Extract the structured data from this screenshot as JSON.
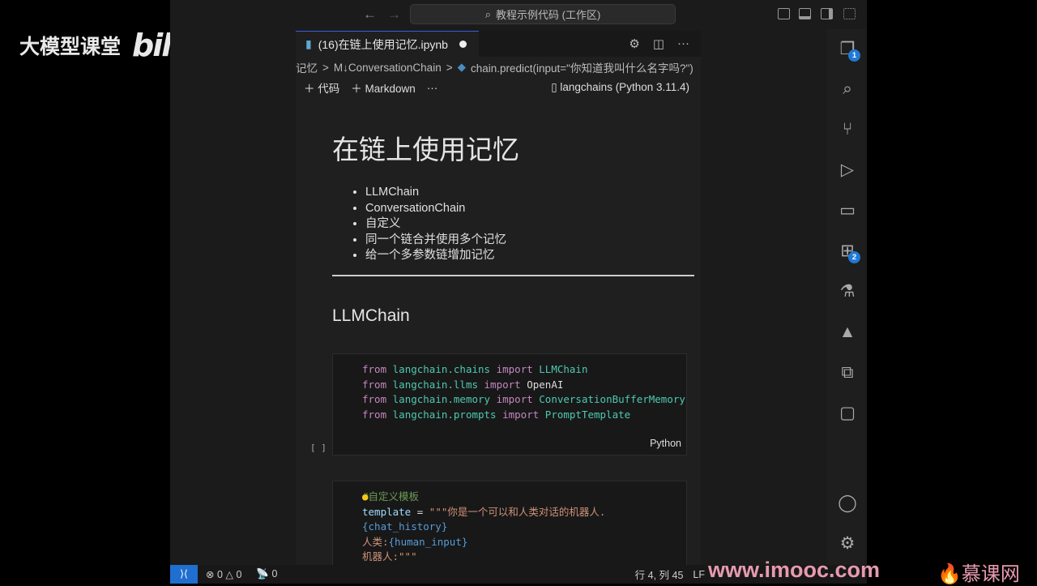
{
  "watermark": {
    "course": "大模型课堂",
    "logo": "bilibili",
    "site": "www.imooc.com",
    "brand": "慕课网"
  },
  "titlebar": {
    "search": "教程示例代码 (工作区)"
  },
  "tab": {
    "title": "(16)在链上使用记忆.ipynb"
  },
  "breadcrumbs": [
    "记忆",
    ">",
    "M↓ConversationChain",
    ">",
    "chain.predict(input=\"你知道我叫什么名字吗?\")"
  ],
  "toolbar": {
    "add_code": "代码",
    "add_markdown": "Markdown",
    "more": "···",
    "kernel": "langchains (Python 3.11.4)"
  },
  "notebook": {
    "title": "在链上使用记忆",
    "bullets": [
      "LLMChain",
      "ConversationChain",
      "自定义",
      "同一个链合并使用多个记忆",
      "给一个多参数链增加记忆"
    ],
    "section": "LLMChain",
    "cell1": {
      "lines": [
        [
          "from",
          "langchain.chains",
          "import",
          "LLMChain"
        ],
        [
          "from",
          "langchain.llms",
          "import",
          "OpenAI"
        ],
        [
          "from",
          "langchain.memory",
          "import",
          "ConversationBufferMemory"
        ],
        [
          "from",
          "langchain.prompts",
          "import",
          "PromptTemplate"
        ]
      ],
      "lang": "Python",
      "exec": "[ ]"
    },
    "cell2": {
      "comment": "#自定义模板",
      "l1a": "template",
      "l1b": " = ",
      "l1c": "\"\"\"你是一个可以和人类对话的机器人.",
      "l2": "{chat_history}",
      "l3a": "人类:",
      "l3b": "{human_input}",
      "l4": "机器人:\"\"\""
    }
  },
  "activity": {
    "explorer_badge": "1",
    "extensions_badge": "2"
  },
  "status": {
    "errors": "0",
    "warnings": "0",
    "ports": "0",
    "position": "行 4, 列 45",
    "eol": "LF"
  }
}
